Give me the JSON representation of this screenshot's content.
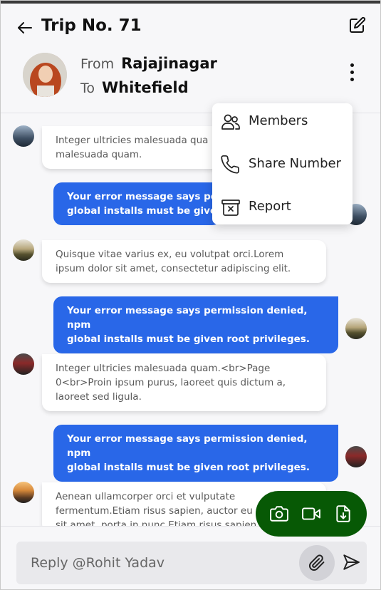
{
  "header": {
    "title": "Trip No. 71",
    "from_label": "From",
    "from_value": "Rajajinagar",
    "to_label": "To",
    "to_value": "Whitefield",
    "icons": {
      "back": "arrow-left-icon",
      "edit": "edit-icon",
      "more": "more-vertical-icon"
    }
  },
  "menu": {
    "items": [
      {
        "label": "Members",
        "icon": "users-icon"
      },
      {
        "label": "Share Number",
        "icon": "phone-icon"
      },
      {
        "label": "Report",
        "icon": "archive-x-icon"
      }
    ]
  },
  "messages": [
    {
      "direction": "in",
      "text_lines": [
        "Integer ultricies malesuada qua",
        "malesuada quam."
      ]
    },
    {
      "direction": "out",
      "text_lines": [
        "Your error message says perm",
        "global installs must be given r"
      ]
    },
    {
      "direction": "in",
      "text_lines": [
        "Quisque vitae varius ex, eu volutpat orci.Lorem",
        "ipsum dolor sit amet, consectetur adipiscing elit."
      ]
    },
    {
      "direction": "out",
      "text_lines": [
        "Your error message says permission denied, npm",
        "global installs must be given root privileges."
      ]
    },
    {
      "direction": "in",
      "text_lines": [
        "Integer ultricies malesuada quam.<br>Page",
        "0<br>Proin ipsum purus, laoreet quis dictum a,",
        "laoreet sed ligula."
      ]
    },
    {
      "direction": "out",
      "text_lines": [
        "Your error message says permission denied, npm",
        "global installs must be given root privileges."
      ]
    },
    {
      "direction": "in",
      "text_lines": [
        "Aenean ullamcorper orci et vulputate",
        "fermentum.Etiam risus sapien, auctor eu",
        "sit amet, porta in nunc.Etiam risus sapien"
      ]
    }
  ],
  "actions": {
    "buttons": [
      {
        "icon": "camera-icon"
      },
      {
        "icon": "video-icon"
      },
      {
        "icon": "file-download-icon"
      }
    ],
    "color": "#075905"
  },
  "reply": {
    "placeholder": "Reply @Rohit Yadav",
    "attach_icon": "paperclip-icon",
    "send_icon": "send-icon"
  },
  "colors": {
    "outgoing_bubble": "#2967e8",
    "incoming_bubble": "#ffffff",
    "background": "#f7f7f9"
  }
}
